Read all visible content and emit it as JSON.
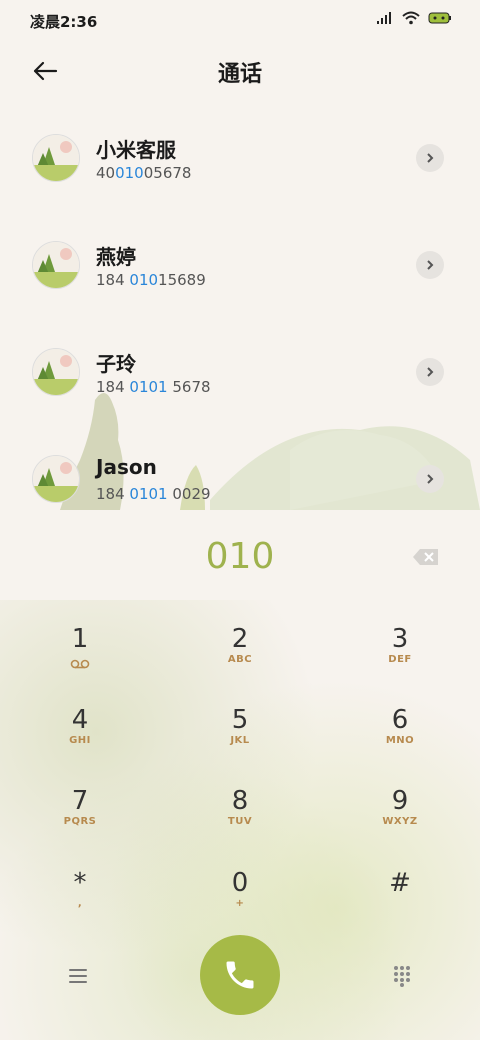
{
  "status": {
    "time": "凌晨2:36"
  },
  "header": {
    "title": "通话"
  },
  "contacts": [
    {
      "name": "小米客服",
      "num_pre": "40",
      "num_hl": "010",
      "num_post": "05678"
    },
    {
      "name": "燕婷",
      "num_pre": "184 ",
      "num_hl": "010",
      "num_post": "15689"
    },
    {
      "name": "子玲",
      "num_pre": "184 ",
      "num_hl": "0101",
      "num_post": " 5678"
    },
    {
      "name": "Jason",
      "num_pre": "184 ",
      "num_hl": "0101",
      "num_post": " 0029"
    }
  ],
  "dialer": {
    "typed": "010"
  },
  "keys": [
    {
      "d": "1",
      "l": ""
    },
    {
      "d": "2",
      "l": "ABC"
    },
    {
      "d": "3",
      "l": "DEF"
    },
    {
      "d": "4",
      "l": "GHI"
    },
    {
      "d": "5",
      "l": "JKL"
    },
    {
      "d": "6",
      "l": "MNO"
    },
    {
      "d": "7",
      "l": "PQRS"
    },
    {
      "d": "8",
      "l": "TUV"
    },
    {
      "d": "9",
      "l": "WXYZ"
    },
    {
      "d": "*",
      "l": ","
    },
    {
      "d": "0",
      "l": "+"
    },
    {
      "d": "#",
      "l": ""
    }
  ],
  "colors": {
    "accent": "#a6ba47",
    "highlight": "#2a86d9",
    "letters": "#b78a4e"
  }
}
